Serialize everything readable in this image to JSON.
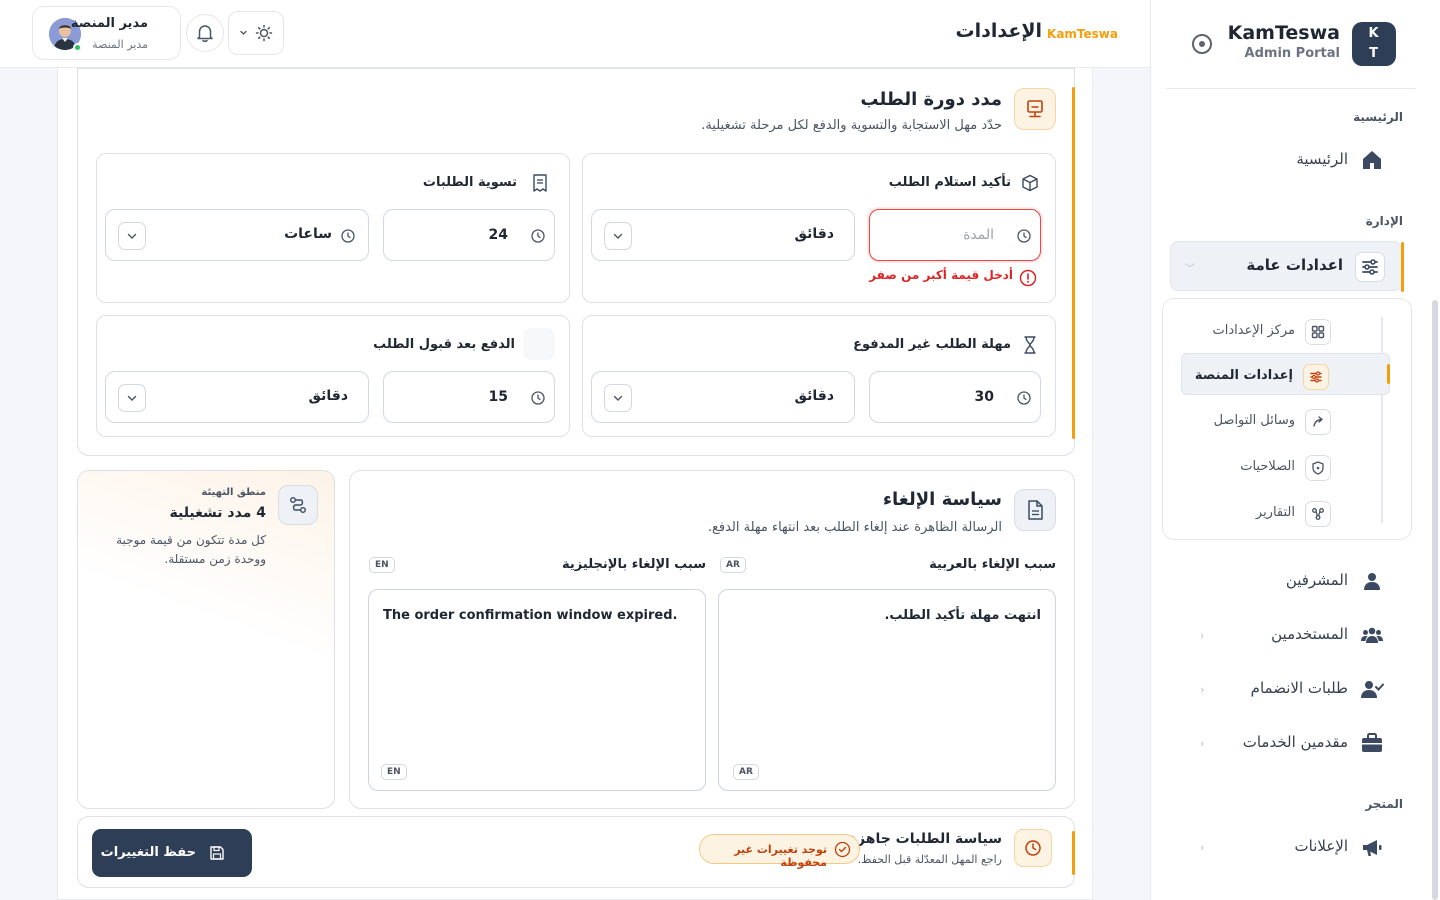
{
  "brand": {
    "logo_text": "K T",
    "name": "KamTeswa",
    "subtitle": "Admin Portal"
  },
  "sidebar": {
    "sections": {
      "main": "الرئيسية",
      "management": "الإدارة",
      "store": "المتجر"
    },
    "home": "الرئيسية",
    "active_group": "اعدادات عامة",
    "submenu": [
      {
        "label": "مركز الإعدادات",
        "icon": "grid-icon"
      },
      {
        "label": "إعدادات المنصة",
        "icon": "sliders-icon"
      },
      {
        "label": "وسائل التواصل",
        "icon": "share-icon"
      },
      {
        "label": "الصلاحيات",
        "icon": "shield-icon"
      },
      {
        "label": "التقارير",
        "icon": "chart-icon"
      }
    ],
    "items": [
      {
        "label": "المشرفين",
        "icon": "supervisor-icon"
      },
      {
        "label": "المستخدمين",
        "icon": "users-icon"
      },
      {
        "label": "طلبات الانضمام",
        "icon": "user-check-icon"
      },
      {
        "label": "مقدمين الخدمات",
        "icon": "briefcase-icon"
      }
    ],
    "store_items": [
      {
        "label": "الإعلانات",
        "icon": "megaphone-icon"
      }
    ]
  },
  "topbar": {
    "title": "الإعدادات",
    "brand": "KamTeswa",
    "user_name": "مدير المنصة",
    "user_role": "مدير المنصة"
  },
  "order_cycle": {
    "title": "مدد دورة الطلب",
    "subtitle": "حدّد مهل الاستجابة والتسوية والدفع لكل مرحلة تشغيلية.",
    "confirm": {
      "title": "تأكيد استلام الطلب",
      "placeholder": "المدة",
      "unit": "دقائق",
      "error": "أدخل قيمة أكبر من صفر"
    },
    "settlement": {
      "title": "تسوية الطلبات",
      "value": "24",
      "unit": "ساعات"
    },
    "unpaid": {
      "title": "مهلة الطلب غير المدفوع",
      "value": "30",
      "unit": "دقائق"
    },
    "payment": {
      "title": "الدفع بعد قبول الطلب",
      "value": "15",
      "unit": "دقائق"
    }
  },
  "cancel_policy": {
    "title": "سياسة الإلغاء",
    "subtitle": "الرسالة الظاهرة عند إلغاء الطلب بعد انتهاء مهلة الدفع.",
    "ar_label": "سبب الإلغاء بالعربية",
    "ar_chip": "AR",
    "ar_text": "انتهت مهلة تأكيد الطلب.",
    "en_label": "سبب الإلغاء بالإنجليزية",
    "en_chip": "EN",
    "en_text": "The order confirmation window expired."
  },
  "info": {
    "kicker": "منطق التهيئة",
    "title": "4 مدد تشغيلية",
    "desc": "كل مدة تتكون من قيمة موجبة ووحدة زمن مستقلة."
  },
  "footer": {
    "title": "سياسة الطلبات جاهزة",
    "subtitle": "راجع المهل المعدّلة قبل الحفظ.",
    "badge": "توجد تغييرات غير محفوظة",
    "save": "حفظ التغييرات"
  },
  "colors": {
    "accent": "#f59e0b",
    "primary": "#2f3e57",
    "error": "#dc2626",
    "success": "#22c55e"
  }
}
